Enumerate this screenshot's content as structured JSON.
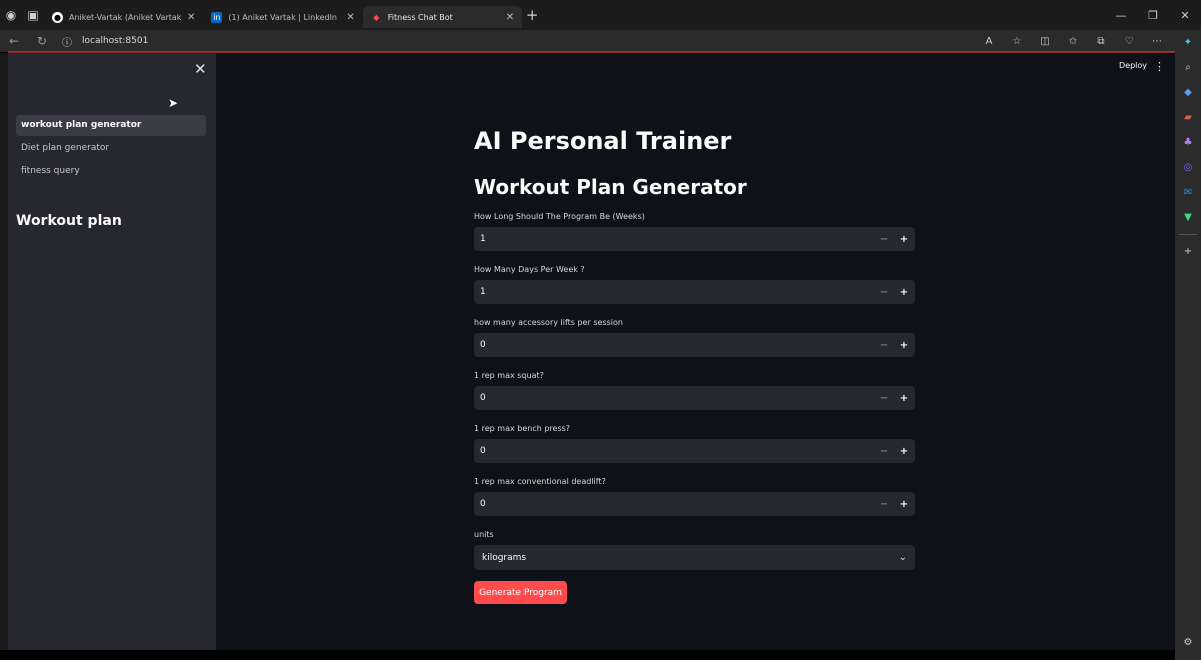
{
  "browser": {
    "tabs": [
      {
        "label": "Aniket-Vartak (Aniket Vartak) · GitH",
        "favicon": "github-icon",
        "active": false
      },
      {
        "label": "(1) Aniket Vartak | LinkedIn",
        "favicon": "linkedin-icon",
        "active": false
      },
      {
        "label": "Fitness Chat Bot",
        "favicon": "streamlit-icon",
        "active": true
      }
    ],
    "new_tab": "+",
    "url": "localhost:8501",
    "window_controls": [
      "—",
      "❐",
      "✕"
    ]
  },
  "sidebar": {
    "nav_items": [
      {
        "label": "workout plan generator",
        "active": true
      },
      {
        "label": "Diet plan generator",
        "active": false
      },
      {
        "label": "fitness query",
        "active": false
      }
    ],
    "title": "Workout plan"
  },
  "header": {
    "deploy_label": "Deploy",
    "menu_icon": "⋮"
  },
  "main": {
    "title": "AI Personal Trainer",
    "subtitle": "Workout Plan Generator",
    "fields": [
      {
        "label": "How Long Should The Program Be (Weeks)",
        "value": "1"
      },
      {
        "label": "How Many Days Per Week ?",
        "value": "1"
      },
      {
        "label": "how many accessory lifts per session",
        "value": "0"
      },
      {
        "label": "1 rep max squat?",
        "value": "0"
      },
      {
        "label": "1 rep max bench press?",
        "value": "0"
      },
      {
        "label": "1 rep max conventional deadlift?",
        "value": "0"
      }
    ],
    "units": {
      "label": "units",
      "value": "kilograms"
    },
    "generate_button": "Generate Program"
  },
  "colors": {
    "app_bg": "#0e1117",
    "sidebar_bg": "#262730",
    "input_bg": "#262730",
    "primary": "#ff4b4b"
  }
}
